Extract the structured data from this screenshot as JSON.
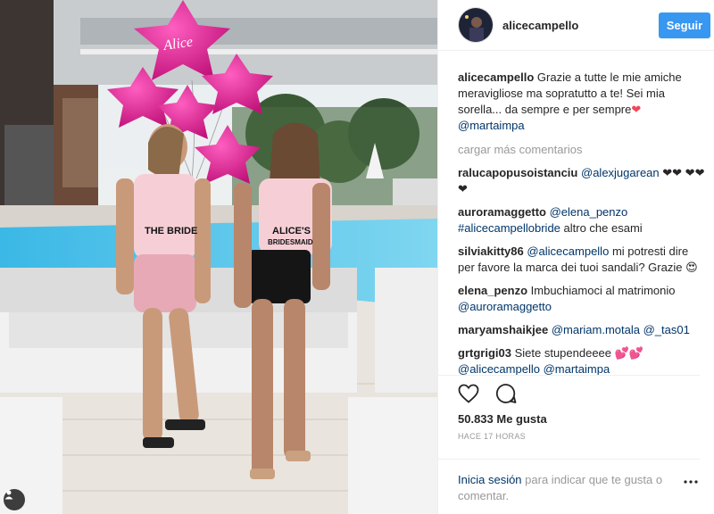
{
  "header": {
    "username": "alicecampello",
    "follow_label": "Seguir"
  },
  "photo": {
    "balloon_text": "Alice",
    "shirt_left": "THE BRIDE",
    "shirt_right_line1": "ALICE'S",
    "shirt_right_line2": "BRIDESMAID"
  },
  "caption": {
    "user": "alicecampello",
    "text": "Grazie a tutte le mie amiche meravigliose ma sopratutto a te! Sei mia sorella... da sempre e per sempre",
    "mention": "@martaimpa"
  },
  "load_more": "cargar más comentarios",
  "comments": [
    {
      "user": "ralucapopusoistanciu",
      "link": "@alexjugarean",
      "text": "❤❤ ❤❤❤"
    },
    {
      "user": "auroramaggetto",
      "link": "@elena_penzo",
      "link2": "#alicecampellobride",
      "text": "altro che esami"
    },
    {
      "user": "silviakitty86",
      "link": "@alicecampello",
      "text": "mi potresti dire per favore la marca dei tuoi sandali? Grazie 😍"
    },
    {
      "user": "elena_penzo",
      "text": "Imbuchiamoci al matrimonio",
      "link": "@auroramaggetto"
    },
    {
      "user": "maryamshaikjee",
      "link": "@mariam.motala",
      "link2": "@_tas01"
    },
    {
      "user": "grtgrigi03",
      "text": "Siete stupendeeee",
      "hearts": "💕💕",
      "link": "@alicecampello",
      "link2": "@martaimpa"
    }
  ],
  "actions": {
    "like_icon": "heart-outline-icon",
    "comment_icon": "comment-bubble-icon"
  },
  "likes": "50.833 Me gusta",
  "timestamp": "HACE 17 HORAS",
  "login": {
    "link": "Inicia sesión",
    "text": "para indicar que te gusta o comentar."
  },
  "colors": {
    "accent": "#3897f0",
    "link": "#003569",
    "balloon": "#e0208e",
    "pool": "#4fc3e8"
  }
}
